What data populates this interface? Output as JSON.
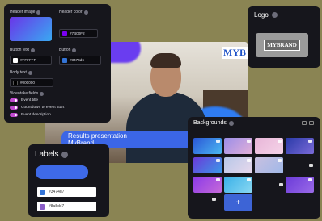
{
  "stage": {
    "brand_text": "MYB",
    "lower_third_line1": "Results presentation",
    "lower_third_line2": "MyBrand"
  },
  "settings": {
    "header_image_label": "Header image",
    "header_color_label": "Header color",
    "header_color_value": "#7B00F2",
    "button_text_label": "Button text",
    "button_text_value": "#FFFFFF",
    "button_label": "Button",
    "button_value": "#3474d6",
    "body_text_label": "Body text",
    "body_text_value": "#000000",
    "videotake_fields_label": "Videotake fields",
    "toggles": [
      {
        "label": "Event title",
        "on": true
      },
      {
        "label": "Countdown to event start",
        "on": true
      },
      {
        "label": "Event description",
        "on": true
      }
    ]
  },
  "logo": {
    "title": "Logo",
    "logo_text": "MYBRAND"
  },
  "labels": {
    "title": "Labels",
    "colors": [
      {
        "hex": "#3474d7",
        "swatch": "#3474d7"
      },
      {
        "hex": "#8a5dc7",
        "swatch": "#8a5dc7"
      }
    ]
  },
  "backgrounds": {
    "title": "Backgrounds",
    "add_label": "+"
  },
  "colors": {
    "panel_bg": "#16161c",
    "accent_blue": "#3e6ae8",
    "toggle_on": "#c14ad0",
    "page_bg": "#8a8453"
  }
}
